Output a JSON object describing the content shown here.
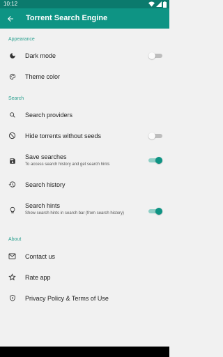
{
  "status_bar": {
    "time": "10:12"
  },
  "app_bar": {
    "title": "Torrent Search Engine"
  },
  "sections": {
    "appearance": "Appearance",
    "search": "Search",
    "about": "About"
  },
  "items": {
    "dark_mode": {
      "label": "Dark mode",
      "toggle": false
    },
    "theme_color": {
      "label": "Theme color"
    },
    "search_providers": {
      "label": "Search providers"
    },
    "hide_torrents": {
      "label": "Hide torrents without seeds",
      "toggle": false
    },
    "save_searches": {
      "label": "Save searches",
      "sub": "To access search history and get search hints",
      "toggle": true
    },
    "search_history": {
      "label": "Search history"
    },
    "search_hints": {
      "label": "Search hints",
      "sub": "Show search hints in search bar (from search history)",
      "toggle": true
    },
    "contact_us": {
      "label": "Contact us"
    },
    "rate_app": {
      "label": "Rate app"
    },
    "privacy": {
      "label": "Privacy Policy & Terms of Use"
    }
  },
  "colors": {
    "primary": "#0e9484",
    "primary_dark": "#0b7a6d",
    "accent_text": "#2aa08f"
  }
}
